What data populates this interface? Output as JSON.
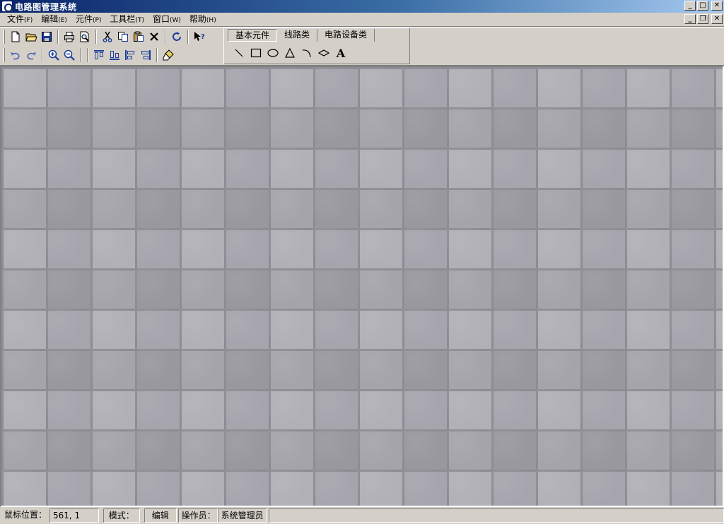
{
  "window": {
    "title": "电路图管理系统",
    "minimize_glyph": "_",
    "maximize_glyph": "□",
    "close_glyph": "✕"
  },
  "mdi": {
    "minimize_glyph": "_",
    "restore_glyph": "❐",
    "close_glyph": "✕"
  },
  "menu": {
    "items": [
      {
        "label": "文件",
        "hotkey": "(F)"
      },
      {
        "label": "编辑",
        "hotkey": "(E)"
      },
      {
        "label": "元件",
        "hotkey": "(P)"
      },
      {
        "label": "工具栏",
        "hotkey": "(T)"
      },
      {
        "label": "窗口",
        "hotkey": "(W)"
      },
      {
        "label": "帮助",
        "hotkey": "(H)"
      }
    ]
  },
  "toolbar": {
    "row1": [
      "new-file-icon",
      "open-folder-icon",
      "save-icon",
      "print-icon",
      "print-preview-icon",
      "cut-icon",
      "copy-icon",
      "paste-icon",
      "delete-icon",
      "refresh-icon",
      "context-help-icon"
    ],
    "row2": [
      "undo-icon",
      "redo-icon",
      "zoom-in-icon",
      "zoom-out-icon",
      "align-top-icon",
      "align-bottom-icon",
      "align-left-icon",
      "align-right-icon",
      "eraser-icon"
    ]
  },
  "shape_panel": {
    "tabs": [
      {
        "label": "基本元件",
        "active": true
      },
      {
        "label": "线路类",
        "active": false
      },
      {
        "label": "电路设备类",
        "active": false
      }
    ],
    "tools": [
      "line-icon",
      "rectangle-icon",
      "ellipse-icon",
      "triangle-icon",
      "arc-icon",
      "diamond-icon",
      "text-icon"
    ],
    "text_tool_glyph": "A"
  },
  "colors": {
    "title_gradient_start": "#0a246a",
    "title_gradient_end": "#a6caf0",
    "chrome": "#d4d0c8",
    "canvas_tile": "#a9a7af",
    "icon_blue": "#1c3c9c"
  },
  "status": {
    "mouse_label": "鼠标位置：",
    "mouse_value": "561, 1",
    "mode_label": "模式：",
    "mode_value": "编辑",
    "operator_label": "操作员：",
    "operator_value": "系统管理员"
  }
}
